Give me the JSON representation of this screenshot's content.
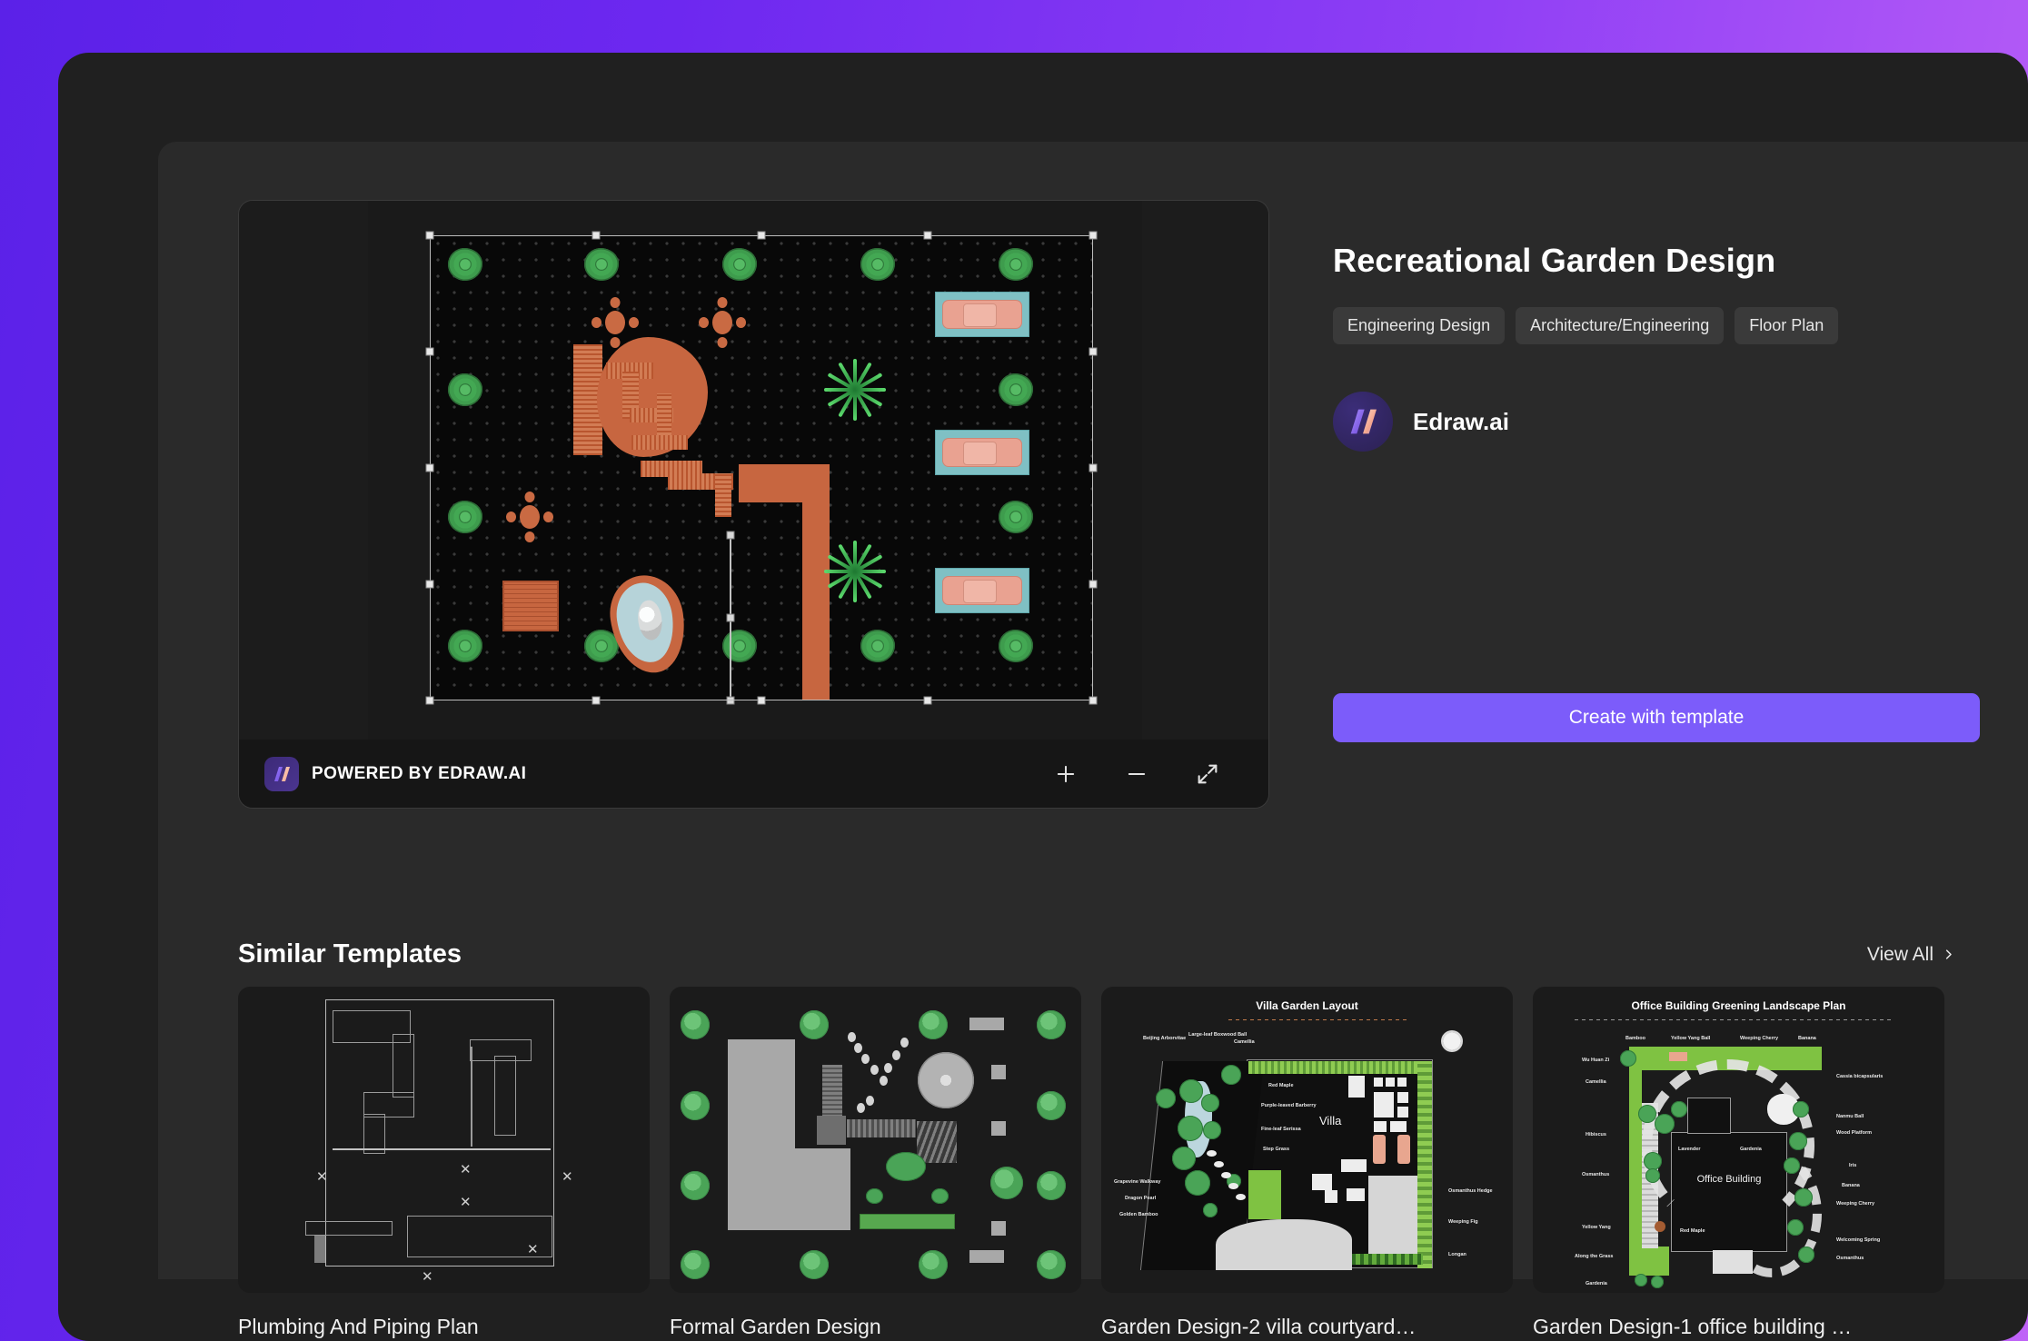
{
  "theme": {
    "bg_gradient_start": "#5b21e8",
    "bg_gradient_end": "#bf63f7",
    "window_bg": "#202020",
    "panel_bg": "#2a2a2a",
    "accent": "#7c5cfa"
  },
  "preview": {
    "toolbar": {
      "powered_by": "POWERED BY EDRAW.AI",
      "zoom_in_label": "+",
      "zoom_out_label": "−",
      "fullscreen_label": "Fullscreen"
    },
    "canvas": {
      "plan_name": "Recreational Garden Design"
    }
  },
  "info": {
    "title": "Recreational Garden Design",
    "tags": [
      "Engineering Design",
      "Architecture/Engineering",
      "Floor Plan"
    ],
    "author": {
      "name": "Edraw.ai"
    },
    "create_button": "Create with template"
  },
  "similar": {
    "heading": "Similar Templates",
    "view_all": "View All",
    "cards": [
      {
        "title": "Plumbing And Piping Plan"
      },
      {
        "title": "Formal Garden Design"
      },
      {
        "title": "Garden Design-2 villa courtyard…",
        "thumb_title": "Villa Garden Layout",
        "thumb_center_label": "Villa",
        "labels_left": [
          "Beijing Arborvitae",
          "Large-leaf Boxwood Ball",
          "Camellia",
          "Grapevine Walkway",
          "Dragon Pearl",
          "Golden Bamboo"
        ],
        "labels_inner": [
          "Red Maple",
          "Purple-leaved Barberry",
          "Fine-leaf Serissa",
          "Step Grass"
        ],
        "labels_right": [
          "Osmanthus Hedge",
          "Weeping Fig",
          "Longan"
        ]
      },
      {
        "title": "Garden Design-1 office building …",
        "thumb_title": "Office Building Greening Landscape Plan",
        "thumb_center_label": "Office Building",
        "labels_top": [
          "Bamboo",
          "Yellow Yang Ball",
          "Weeping Cherry",
          "Banana"
        ],
        "labels_left": [
          "Wu Huan Zi",
          "Camellia",
          "Hibiscus",
          "Osmanthus",
          "Yellow Yang",
          "Along the Grass",
          "Gardenia"
        ],
        "labels_right": [
          "Cassia bicapsularis",
          "Nanmu Ball",
          "Wood Platform",
          "Iris",
          "Banana",
          "Weeping Cherry",
          "Welcoming Spring",
          "Osmanthus"
        ],
        "labels_inner": [
          "Lavender",
          "Gardenia",
          "Red Maple"
        ]
      }
    ]
  }
}
